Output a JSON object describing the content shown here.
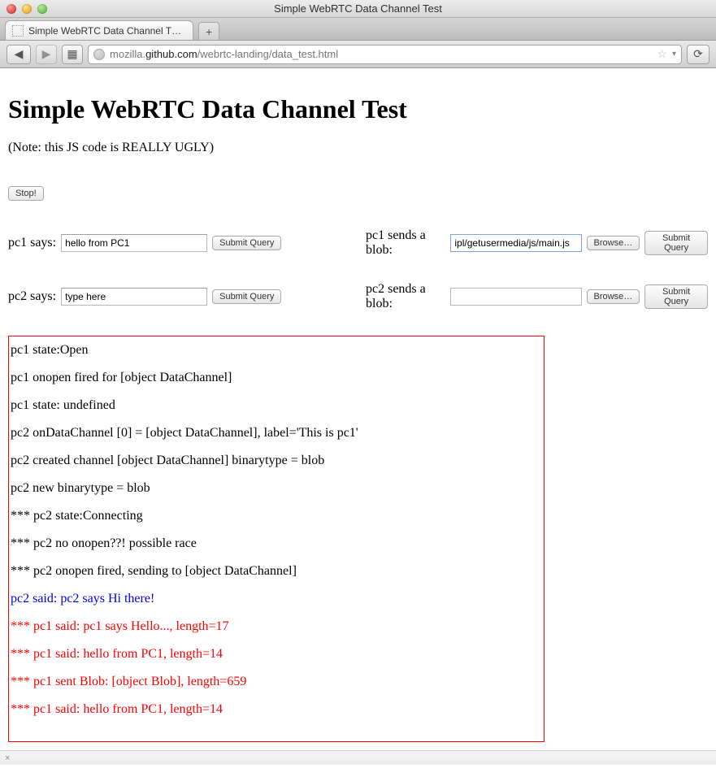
{
  "window": {
    "title": "Simple WebRTC Data Channel Test"
  },
  "tab": {
    "title": "Simple WebRTC Data Channel T…",
    "newtab_glyph": "+"
  },
  "nav": {
    "back_glyph": "◀",
    "fwd_glyph": "▶",
    "book_glyph": "▦",
    "reload_glyph": "⟳",
    "star_glyph": "☆",
    "drop_glyph": "▾"
  },
  "url": {
    "prefix": "mozilla.",
    "domain": "github.com",
    "rest": "/webrtc-landing/data_test.html"
  },
  "page": {
    "heading": "Simple WebRTC Data Channel Test",
    "note": "(Note: this JS code is REALLY UGLY)",
    "stop_label": "Stop!",
    "pc1_says_label": "pc1 says: ",
    "pc2_says_label": "pc2 says: ",
    "pc1_blob_label": "pc1 sends a blob: ",
    "pc2_blob_label": "pc2 sends a blob: ",
    "pc1_input_value": "hello from PC1",
    "pc2_input_value": "type here",
    "submit_label": "Submit Query",
    "browse_label": "Browse…",
    "pc1_file_value": "ipl/getusermedia/js/main.js",
    "pc2_file_value": ""
  },
  "log": [
    {
      "cls": "",
      "text": "pc1 state:Open"
    },
    {
      "cls": "",
      "text": "pc1 onopen fired for [object DataChannel]"
    },
    {
      "cls": "",
      "text": "pc1 state: undefined"
    },
    {
      "cls": "",
      "text": "pc2 onDataChannel [0] = [object DataChannel], label='This is pc1'"
    },
    {
      "cls": "",
      "text": "pc2 created channel [object DataChannel] binarytype = blob"
    },
    {
      "cls": "",
      "text": "pc2 new binarytype = blob"
    },
    {
      "cls": "",
      "text": "*** pc2 state:Connecting"
    },
    {
      "cls": "",
      "text": "*** pc2 no onopen??! possible race"
    },
    {
      "cls": "",
      "text": "*** pc2 onopen fired, sending to [object DataChannel]"
    },
    {
      "cls": "blue",
      "text": "pc2 said: pc2 says Hi there!"
    },
    {
      "cls": "red",
      "text": "*** pc1 said: pc1 says Hello..., length=17"
    },
    {
      "cls": "red",
      "text": "*** pc1 said: hello from PC1, length=14"
    },
    {
      "cls": "red",
      "text": "*** pc1 sent Blob: [object Blob], length=659"
    },
    {
      "cls": "red",
      "text": "*** pc1 said: hello from PC1, length=14"
    }
  ],
  "statusbar_glyph": "×"
}
